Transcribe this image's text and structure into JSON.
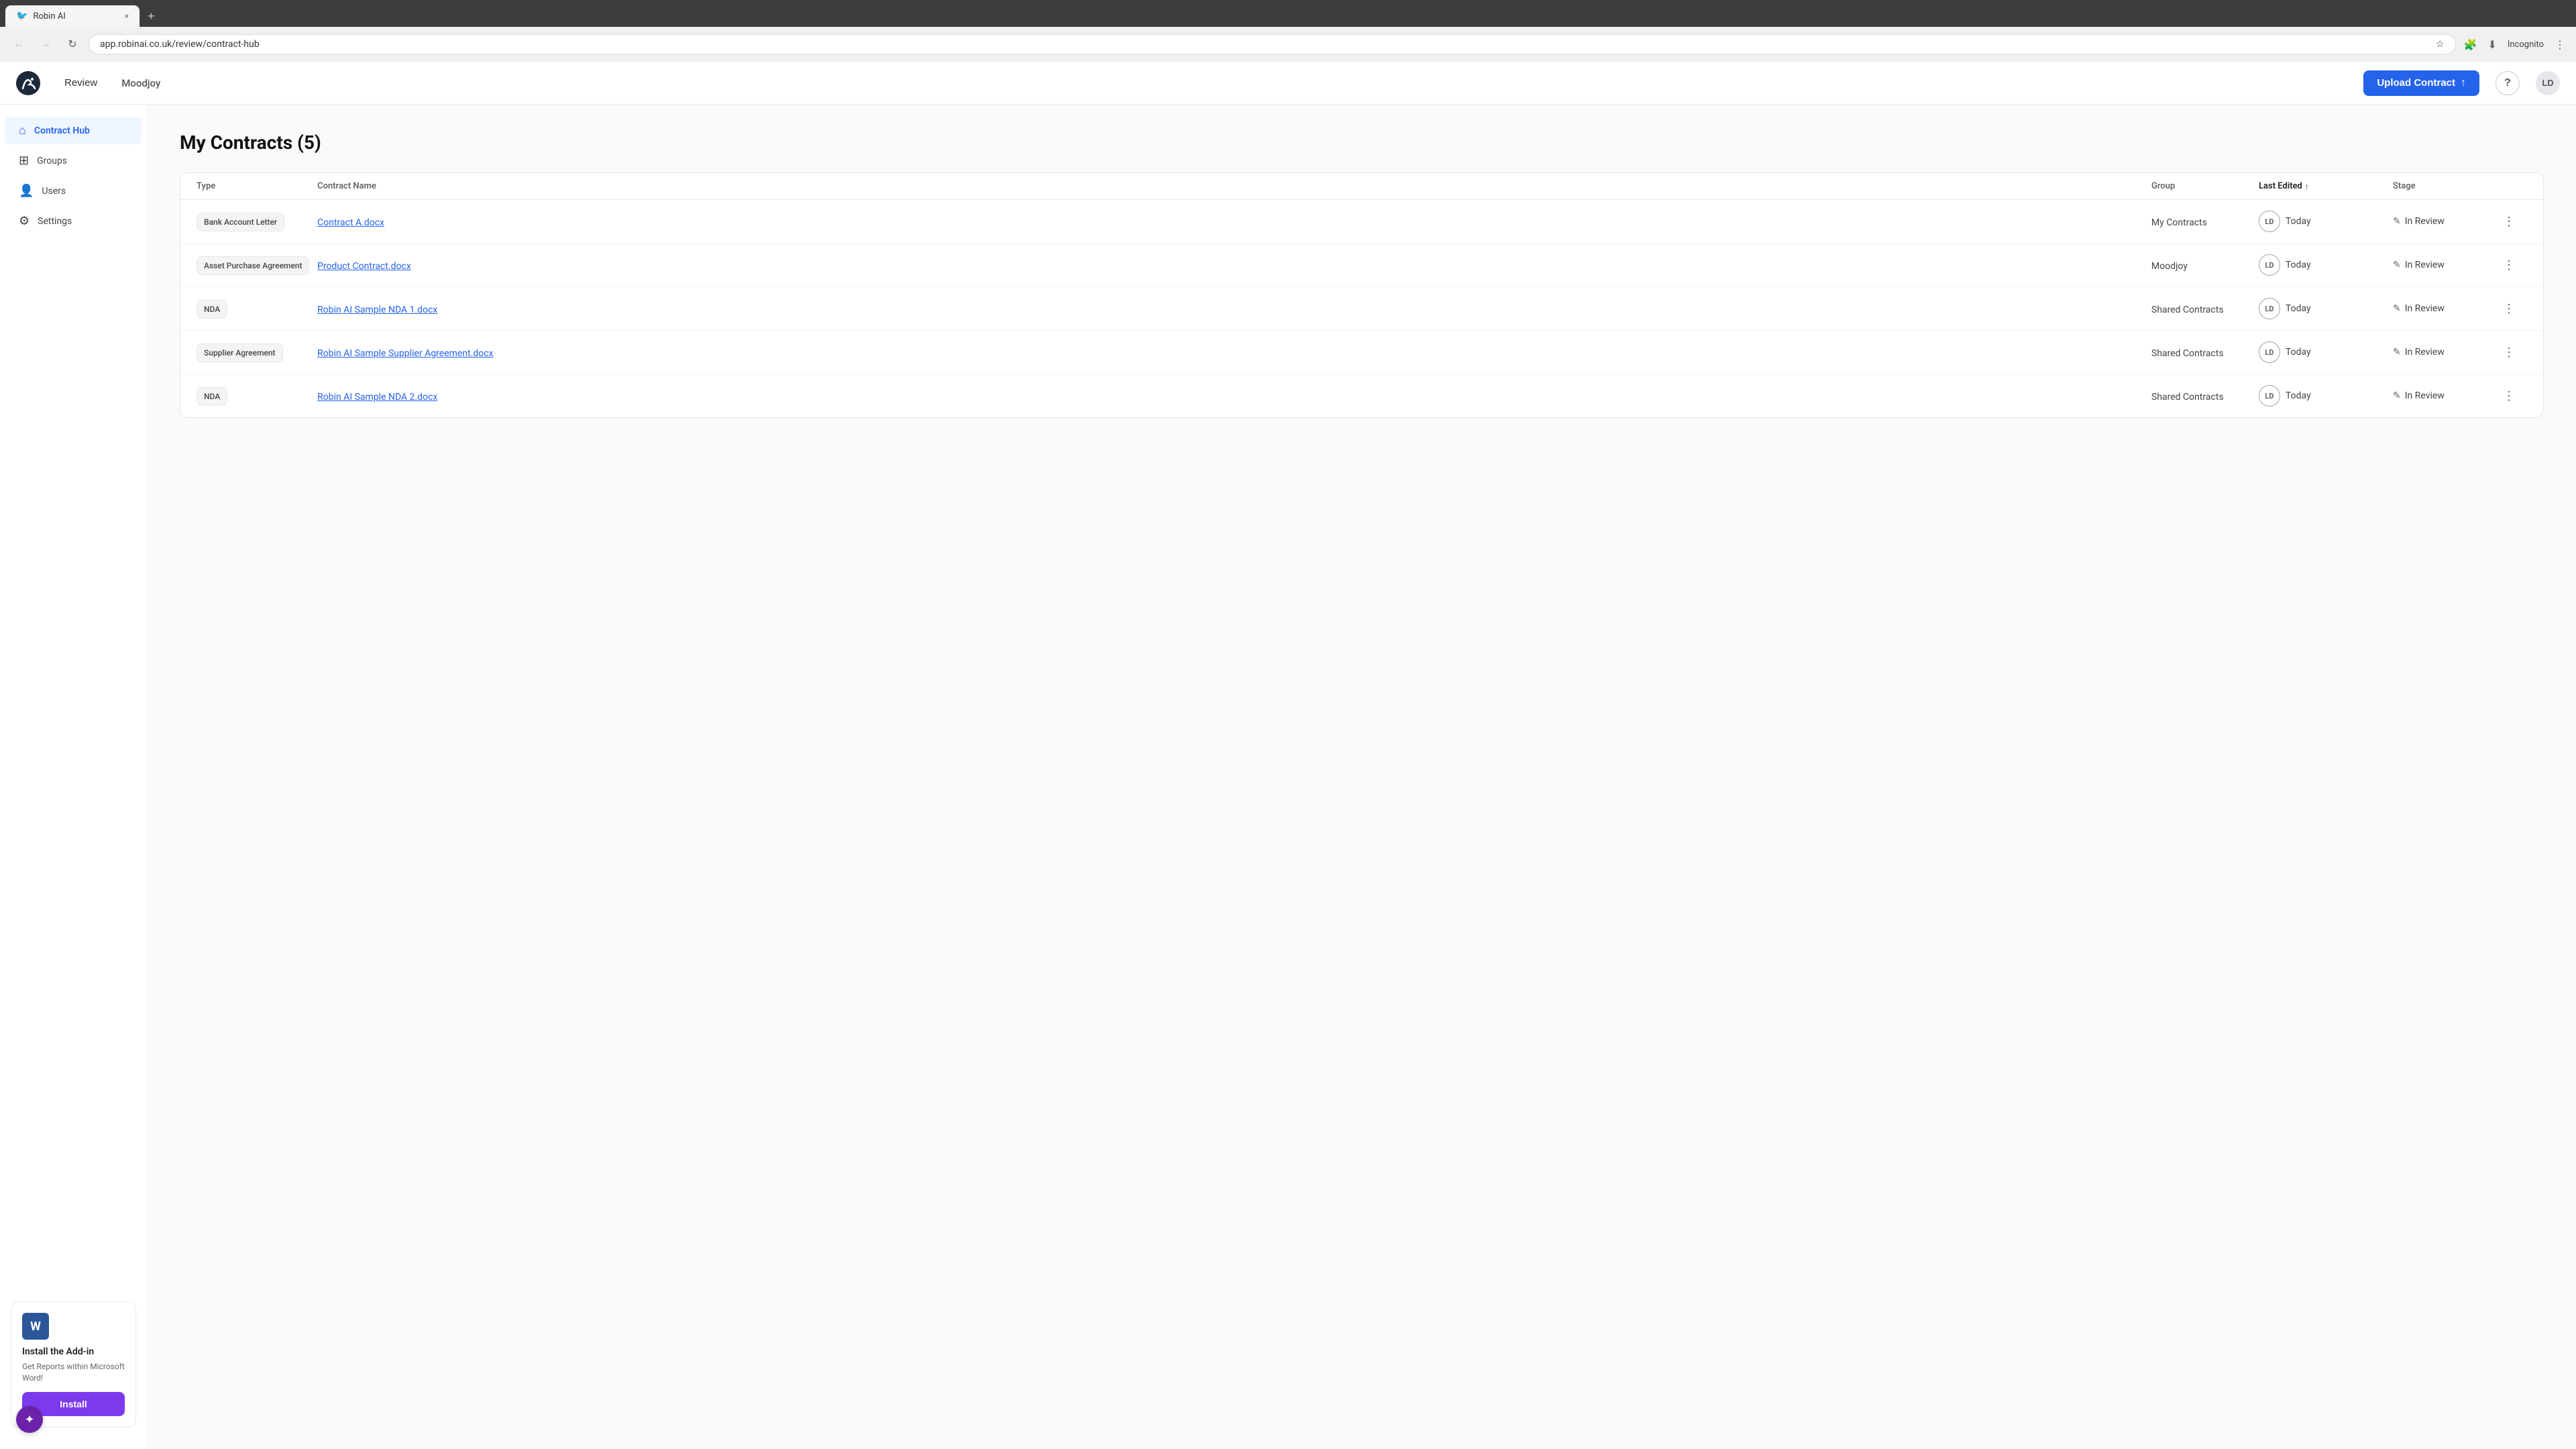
{
  "browser": {
    "tab_label": "Robin AI",
    "tab_close": "×",
    "tab_new": "+",
    "url": "app.robinai.co.uk/review/contract-hub",
    "back_btn": "←",
    "forward_btn": "→",
    "refresh_btn": "↻",
    "incognito_label": "Incognito"
  },
  "header": {
    "nav_label": "Review",
    "workspace": "Moodjoy",
    "upload_label": "Upload Contract",
    "upload_icon": "↑",
    "help_label": "?",
    "avatar_label": "LD"
  },
  "sidebar": {
    "items": [
      {
        "id": "contract-hub",
        "label": "Contract Hub",
        "icon": "⌂",
        "active": true
      },
      {
        "id": "groups",
        "label": "Groups",
        "icon": "⊞",
        "active": false
      },
      {
        "id": "users",
        "label": "Users",
        "icon": "👤",
        "active": false
      },
      {
        "id": "settings",
        "label": "Settings",
        "icon": "⚙",
        "active": false
      }
    ],
    "addon": {
      "word_icon": "W",
      "title": "Install the Add-in",
      "description": "Get Reports within Microsoft Word!",
      "install_label": "Install"
    }
  },
  "content": {
    "page_title": "My Contracts (5)",
    "table": {
      "columns": [
        {
          "id": "type",
          "label": "Type"
        },
        {
          "id": "contract_name",
          "label": "Contract Name"
        },
        {
          "id": "group",
          "label": "Group"
        },
        {
          "id": "last_edited",
          "label": "Last Edited",
          "sorted": true
        },
        {
          "id": "stage",
          "label": "Stage"
        },
        {
          "id": "actions",
          "label": ""
        }
      ],
      "rows": [
        {
          "type": "Bank Account Letter",
          "contract_name": "Contract A.docx",
          "group": "My Contracts",
          "avatar": "LD",
          "last_edited": "Today",
          "stage": "In Review"
        },
        {
          "type": "Asset Purchase Agreement",
          "contract_name": "Product Contract.docx",
          "group": "Moodjoy",
          "avatar": "LD",
          "last_edited": "Today",
          "stage": "In Review"
        },
        {
          "type": "NDA",
          "contract_name": "Robin AI Sample NDA 1.docx",
          "group": "Shared Contracts",
          "avatar": "LD",
          "last_edited": "Today",
          "stage": "In Review"
        },
        {
          "type": "Supplier Agreement",
          "contract_name": "Robin AI Sample Supplier Agreement.docx",
          "group": "Shared Contracts",
          "avatar": "LD",
          "last_edited": "Today",
          "stage": "In Review"
        },
        {
          "type": "NDA",
          "contract_name": "Robin AI Sample NDA 2.docx",
          "group": "Shared Contracts",
          "avatar": "LD",
          "last_edited": "Today",
          "stage": "In Review"
        }
      ]
    }
  },
  "colors": {
    "brand_blue": "#2563eb",
    "brand_purple": "#7c3aed",
    "active_sidebar": "#eff6ff"
  }
}
